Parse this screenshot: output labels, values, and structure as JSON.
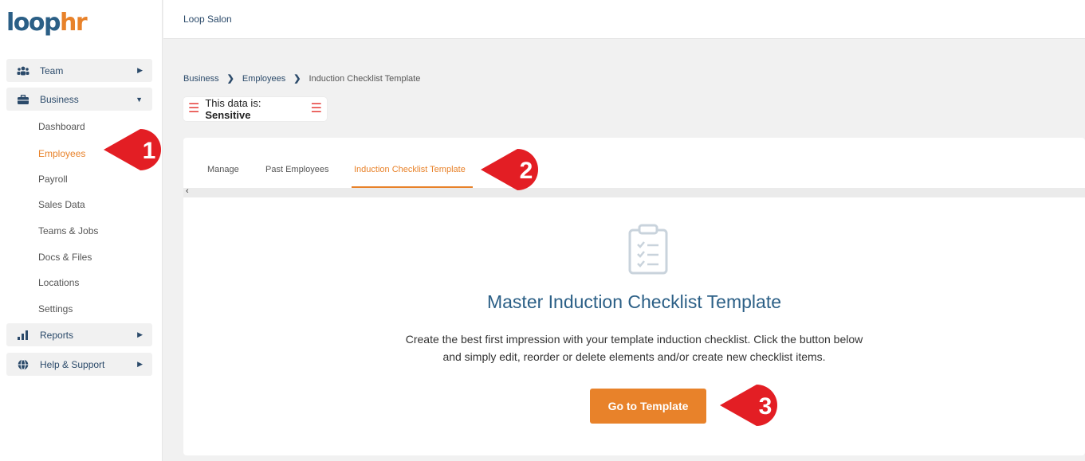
{
  "logo": {
    "part1": "loop",
    "part2": "hr"
  },
  "header": {
    "brand": "Loop Salon"
  },
  "sidebar": {
    "groups": [
      {
        "label": "Team",
        "icon": "team-icon"
      },
      {
        "label": "Business",
        "icon": "briefcase-icon"
      },
      {
        "label": "Reports",
        "icon": "bar-chart-icon"
      },
      {
        "label": "Help & Support",
        "icon": "globe-icon"
      }
    ],
    "business_items": [
      "Dashboard",
      "Employees",
      "Payroll",
      "Sales Data",
      "Teams & Jobs",
      "Docs & Files",
      "Locations",
      "Settings"
    ],
    "active_item": "Employees"
  },
  "breadcrumb": [
    "Business",
    "Employees",
    "Induction Checklist Template"
  ],
  "sensitivity": {
    "prefix": "This data is:",
    "level": "Sensitive"
  },
  "tabs": [
    "Manage",
    "Past Employees",
    "Induction Checklist Template"
  ],
  "active_tab": "Induction Checklist Template",
  "content": {
    "title": "Master Induction Checklist Template",
    "description_line1": "Create the best first impression with your template induction checklist. Click the button below",
    "description_line2": "and simply edit, reorder or delete elements and/or create new checklist items.",
    "button_label": "Go to Template"
  },
  "callouts": [
    "1",
    "2",
    "3"
  ],
  "colors": {
    "accent": "#e8822a",
    "brand_blue": "#2b5f86",
    "callout_red": "#e31e24"
  }
}
